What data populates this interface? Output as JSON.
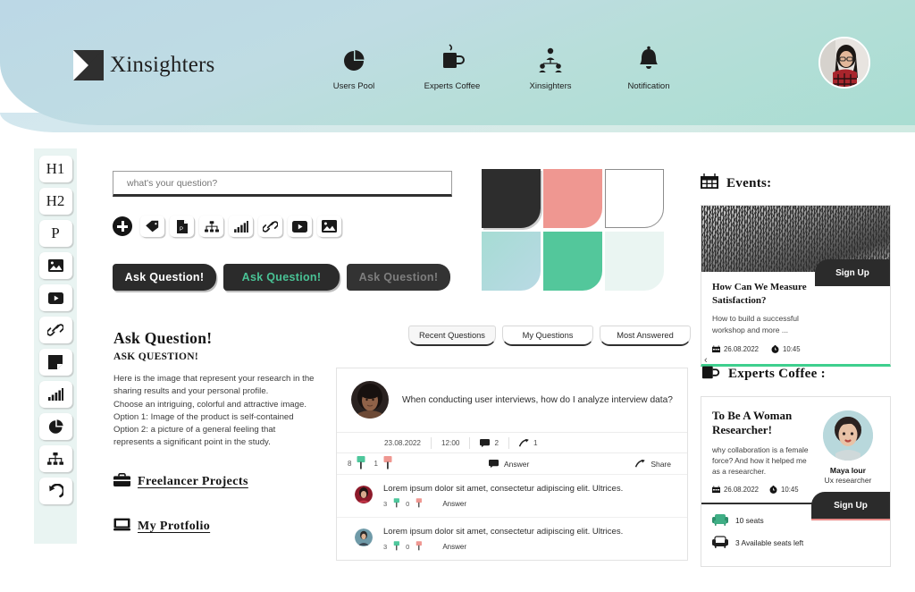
{
  "header": {
    "brand": "Xinsighters",
    "brand_logo_icon": "x-logo-icon",
    "avatar_icon": "user-avatar",
    "nav": [
      {
        "label": "Users Pool",
        "icon": "pie-chart-icon"
      },
      {
        "label": "Experts  Coffee",
        "icon": "coffee-mug-icon"
      },
      {
        "label": "Xinsighters",
        "icon": "people-group-icon"
      },
      {
        "label": "Notification",
        "icon": "bell-icon"
      }
    ]
  },
  "rail": {
    "items": [
      {
        "label": "H1",
        "icon": "heading-1-icon",
        "type": "text"
      },
      {
        "label": "H2",
        "icon": "heading-2-icon",
        "type": "text"
      },
      {
        "label": "P",
        "icon": "paragraph-icon",
        "type": "text"
      },
      {
        "label": "",
        "icon": "image-icon",
        "type": "glyph"
      },
      {
        "label": "",
        "icon": "video-icon",
        "type": "glyph"
      },
      {
        "label": "",
        "icon": "link-icon",
        "type": "glyph"
      },
      {
        "label": "",
        "icon": "note-icon",
        "type": "glyph"
      },
      {
        "label": "",
        "icon": "bar-chart-icon",
        "type": "glyph"
      },
      {
        "label": "",
        "icon": "pie-chart-icon",
        "type": "glyph"
      },
      {
        "label": "",
        "icon": "sitemap-icon",
        "type": "glyph"
      },
      {
        "label": "",
        "icon": "undo-arrow-icon",
        "type": "glyph"
      }
    ]
  },
  "composer": {
    "placeholder": "what's your question?",
    "value": "",
    "add_icon": "plus-circle-icon",
    "tools": [
      {
        "icon": "tag-icon"
      },
      {
        "icon": "file-pdf-icon"
      },
      {
        "icon": "sitemap-icon"
      },
      {
        "icon": "bar-chart-icon"
      },
      {
        "icon": "link-icon"
      },
      {
        "icon": "video-icon"
      },
      {
        "icon": "image-icon"
      }
    ],
    "buttons": [
      {
        "label": "Ask Question!",
        "state": "default"
      },
      {
        "label": "Ask Question!",
        "state": "active"
      },
      {
        "label": "Ask Question!",
        "state": "disabled"
      }
    ]
  },
  "swatches": [
    {
      "name": "dark",
      "color": "#2d2d2d"
    },
    {
      "name": "salmon",
      "color": "#ef9791"
    },
    {
      "name": "white",
      "color": "#ffffff"
    },
    {
      "name": "mint-gradient",
      "color": "#a9ddd5"
    },
    {
      "name": "green",
      "color": "#53c79b"
    },
    {
      "name": "pale-mint",
      "color": "#eaf5f2"
    }
  ],
  "article": {
    "h1": "Ask Question!",
    "h2": "ASK QUESTION!",
    "paragraph": "Here is the image that represent your research in the sharing results and your personal profile.\nChoose an intriguing, colorful and attractive image.\nOption 1: Image of the product is self-contained\nOption 2: a picture of a general feeling that represents a significant point in the study.",
    "links": [
      {
        "label": "Freelancer Projects",
        "icon": "briefcase-icon"
      },
      {
        "label": "My Protfolio",
        "icon": "book-icon"
      }
    ]
  },
  "tabs": [
    {
      "label": "Recent Questions",
      "selected": true
    },
    {
      "label": "My Questions",
      "selected": false
    },
    {
      "label": "Most Answered",
      "selected": false
    }
  ],
  "question_card": {
    "author_avatar_icon": "question-author-avatar",
    "text": "When conducting user interviews, how do I analyze interview data?",
    "date": "23.08.2022",
    "time": "12:00",
    "comment_icon": "comment-icon",
    "comment_count": "2",
    "share_icon": "share-arrow-icon",
    "share_count": "1",
    "upvotes": "8",
    "downvotes": "1",
    "upvote_icon": "thumb-up-icon",
    "downvote_icon": "thumb-down-icon",
    "answer_label": "Answer",
    "share_label": "Share",
    "replies": [
      {
        "avatar_icon": "reply-author-avatar-1",
        "text": "Lorem ipsum dolor sit amet, consectetur adipiscing elit. Ultrices.",
        "upvotes": "3",
        "downvotes": "0",
        "answer_label": "Answer"
      },
      {
        "avatar_icon": "reply-author-avatar-2",
        "text": "Lorem ipsum dolor sit amet, consectetur adipiscing elit. Ultrices.",
        "upvotes": "3",
        "downvotes": "0",
        "answer_label": "Answer"
      }
    ]
  },
  "events": {
    "title": "Events:",
    "title_icon": "calendar-icon",
    "card": {
      "image_icon": "wave-mesh-artwork",
      "heading": "How Can We Measure Satisfaction?",
      "description": "How to build a successful workshop and more ...",
      "date": "26.08.2022",
      "date_icon": "calendar-icon",
      "time": "10:45",
      "time_icon": "clock-icon",
      "signup_label": "Sign Up",
      "accent_color": "#3ecf8e"
    }
  },
  "experts_coffee": {
    "title": "Experts Coffee :",
    "title_icon": "coffee-mug-icon",
    "card": {
      "heading": "To Be A Woman Researcher!",
      "description": "why collaboration is a female force? And how it helped me as a researcher.",
      "date": "26.08.2022",
      "date_icon": "calendar-icon",
      "time": "10:45",
      "time_icon": "clock-icon",
      "speaker_name": "Maya lour",
      "speaker_role": "Ux researcher",
      "speaker_avatar_icon": "speaker-avatar",
      "seats_total": "10 seats",
      "seats_total_icon": "armchair-green-icon",
      "seats_left": "3 Available seats left",
      "seats_left_icon": "armchair-icon",
      "signup_label": "Sign Up",
      "accent_color": "#e98a88"
    }
  }
}
